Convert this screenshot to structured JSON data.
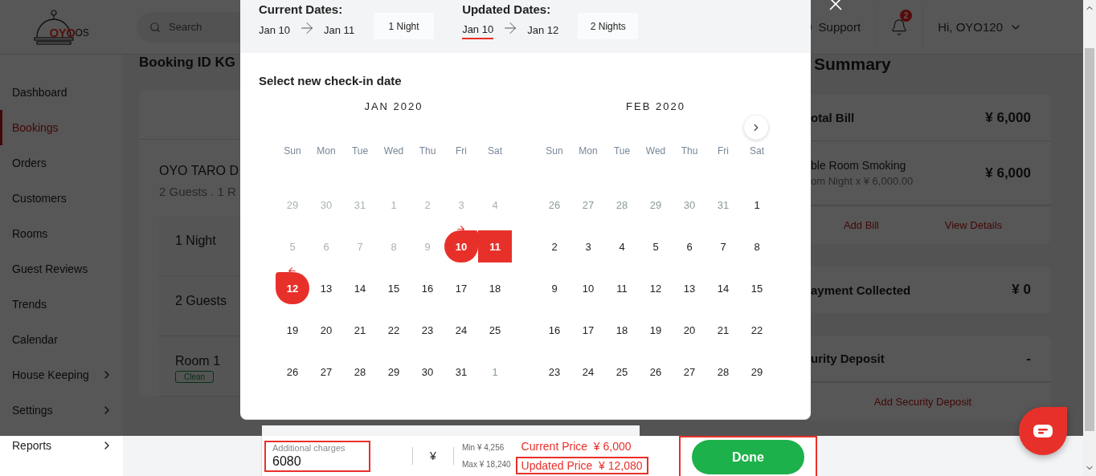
{
  "header": {
    "logo_brand": "OYO",
    "logo_suffix": "OS",
    "search": {
      "placeholder": "Search"
    },
    "support": "Support",
    "notification_count": "2",
    "user": "Hi, OYO120"
  },
  "sidebar": {
    "items": [
      {
        "label": "Dashboard",
        "selected": false,
        "has_submenu": false
      },
      {
        "label": "Bookings",
        "selected": true,
        "has_submenu": false
      },
      {
        "label": "Orders",
        "selected": false,
        "has_submenu": false
      },
      {
        "label": "Customers",
        "selected": false,
        "has_submenu": false
      },
      {
        "label": "Rooms",
        "selected": false,
        "has_submenu": false
      },
      {
        "label": "Guest Reviews",
        "selected": false,
        "has_submenu": false
      },
      {
        "label": "Trends",
        "selected": false,
        "has_submenu": false
      },
      {
        "label": "Calendar",
        "selected": false,
        "has_submenu": false
      },
      {
        "label": "House Keeping",
        "selected": false,
        "has_submenu": true
      },
      {
        "label": "Settings",
        "selected": false,
        "has_submenu": true
      },
      {
        "label": "Reports",
        "selected": false,
        "has_submenu": true
      }
    ]
  },
  "booking": {
    "title": "Booking ID KG",
    "hotel": "OYO TARO D",
    "guests_summary": "2 Guests . 1 R",
    "rows": [
      {
        "text": "1 Night"
      },
      {
        "text": "2 Guests"
      },
      {
        "text": "Room 1",
        "tag": "Clean"
      }
    ]
  },
  "summary": {
    "title": "Summary",
    "cards": [
      {
        "rows": [
          {
            "label": "otal Bill",
            "amount": "¥ 6,000"
          },
          {
            "label": "ble Room Smoking",
            "detail": "om Night x ¥ 6,000.00",
            "amount": "¥ 6,000"
          }
        ],
        "links": [
          "Add Bill",
          "View Details"
        ]
      },
      {
        "rows": [
          {
            "label": "ayment Collected",
            "amount": "¥ 0"
          }
        ]
      },
      {
        "rows": [
          {
            "label": "urity Deposit",
            "amount": "-"
          }
        ],
        "links": [
          "Add Security Deposit"
        ]
      }
    ]
  },
  "modal": {
    "current": {
      "label": "Current Dates:",
      "from": "Jan 10",
      "to": "Jan 11",
      "nights": "1 Night",
      "from_active": false
    },
    "updated": {
      "label": "Updated Dates:",
      "from": "Jan 10",
      "to": "Jan 12",
      "nights": "2 Nights",
      "from_active": true
    },
    "prompt": "Select new check-in date",
    "months": [
      {
        "title": "JAN 2020",
        "weekdays": [
          "Sun",
          "Mon",
          "Tue",
          "Wed",
          "Thu",
          "Fri",
          "Sat"
        ],
        "days": [
          {
            "d": "29",
            "kind": "disabled"
          },
          {
            "d": "30",
            "kind": "disabled"
          },
          {
            "d": "31",
            "kind": "disabled"
          },
          {
            "d": "1",
            "kind": "disabled"
          },
          {
            "d": "2",
            "kind": "disabled"
          },
          {
            "d": "3",
            "kind": "disabled"
          },
          {
            "d": "4",
            "kind": "disabled"
          },
          {
            "d": "5",
            "kind": "disabled"
          },
          {
            "d": "6",
            "kind": "disabled"
          },
          {
            "d": "7",
            "kind": "disabled"
          },
          {
            "d": "8",
            "kind": "disabled"
          },
          {
            "d": "9",
            "kind": "disabled"
          },
          {
            "d": "10",
            "kind": "start"
          },
          {
            "d": "11",
            "kind": "range"
          },
          {
            "d": "12",
            "kind": "end"
          },
          {
            "d": "13",
            "kind": "normal"
          },
          {
            "d": "14",
            "kind": "normal"
          },
          {
            "d": "15",
            "kind": "normal"
          },
          {
            "d": "16",
            "kind": "normal"
          },
          {
            "d": "17",
            "kind": "normal"
          },
          {
            "d": "18",
            "kind": "normal"
          },
          {
            "d": "19",
            "kind": "normal"
          },
          {
            "d": "20",
            "kind": "normal"
          },
          {
            "d": "21",
            "kind": "normal"
          },
          {
            "d": "22",
            "kind": "normal"
          },
          {
            "d": "23",
            "kind": "normal"
          },
          {
            "d": "24",
            "kind": "normal"
          },
          {
            "d": "25",
            "kind": "normal"
          },
          {
            "d": "26",
            "kind": "normal"
          },
          {
            "d": "27",
            "kind": "normal"
          },
          {
            "d": "28",
            "kind": "normal"
          },
          {
            "d": "29",
            "kind": "normal"
          },
          {
            "d": "30",
            "kind": "normal"
          },
          {
            "d": "31",
            "kind": "normal"
          },
          {
            "d": "1",
            "kind": "muted"
          }
        ]
      },
      {
        "title": "FEB 2020",
        "weekdays": [
          "Sun",
          "Mon",
          "Tue",
          "Wed",
          "Thu",
          "Fri",
          "Sat"
        ],
        "days": [
          {
            "d": "26",
            "kind": "muted"
          },
          {
            "d": "27",
            "kind": "muted"
          },
          {
            "d": "28",
            "kind": "muted"
          },
          {
            "d": "29",
            "kind": "muted"
          },
          {
            "d": "30",
            "kind": "muted"
          },
          {
            "d": "31",
            "kind": "muted"
          },
          {
            "d": "1",
            "kind": "normal"
          },
          {
            "d": "2",
            "kind": "normal"
          },
          {
            "d": "3",
            "kind": "normal"
          },
          {
            "d": "4",
            "kind": "normal"
          },
          {
            "d": "5",
            "kind": "normal"
          },
          {
            "d": "6",
            "kind": "normal"
          },
          {
            "d": "7",
            "kind": "normal"
          },
          {
            "d": "8",
            "kind": "normal"
          },
          {
            "d": "9",
            "kind": "normal"
          },
          {
            "d": "10",
            "kind": "normal"
          },
          {
            "d": "11",
            "kind": "normal"
          },
          {
            "d": "12",
            "kind": "normal"
          },
          {
            "d": "13",
            "kind": "normal"
          },
          {
            "d": "14",
            "kind": "normal"
          },
          {
            "d": "15",
            "kind": "normal"
          },
          {
            "d": "16",
            "kind": "normal"
          },
          {
            "d": "17",
            "kind": "normal"
          },
          {
            "d": "18",
            "kind": "normal"
          },
          {
            "d": "19",
            "kind": "normal"
          },
          {
            "d": "20",
            "kind": "normal"
          },
          {
            "d": "21",
            "kind": "normal"
          },
          {
            "d": "22",
            "kind": "normal"
          },
          {
            "d": "23",
            "kind": "normal"
          },
          {
            "d": "24",
            "kind": "normal"
          },
          {
            "d": "25",
            "kind": "normal"
          },
          {
            "d": "26",
            "kind": "normal"
          },
          {
            "d": "27",
            "kind": "normal"
          },
          {
            "d": "28",
            "kind": "normal"
          },
          {
            "d": "29",
            "kind": "normal"
          }
        ]
      }
    ]
  },
  "footer": {
    "charges": {
      "placeholder": "Additional charges",
      "value": "6080",
      "highlighted": true
    },
    "currency": "¥",
    "min": "Min ¥ 4,256",
    "max": "Max ¥ 18,240",
    "current_price": {
      "text": "Current Price  ¥ 6,000",
      "highlighted": false
    },
    "updated_price": {
      "text": "Updated Price  ¥ 12,080",
      "highlighted": true
    },
    "done": {
      "label": "Done",
      "highlighted": true
    }
  }
}
